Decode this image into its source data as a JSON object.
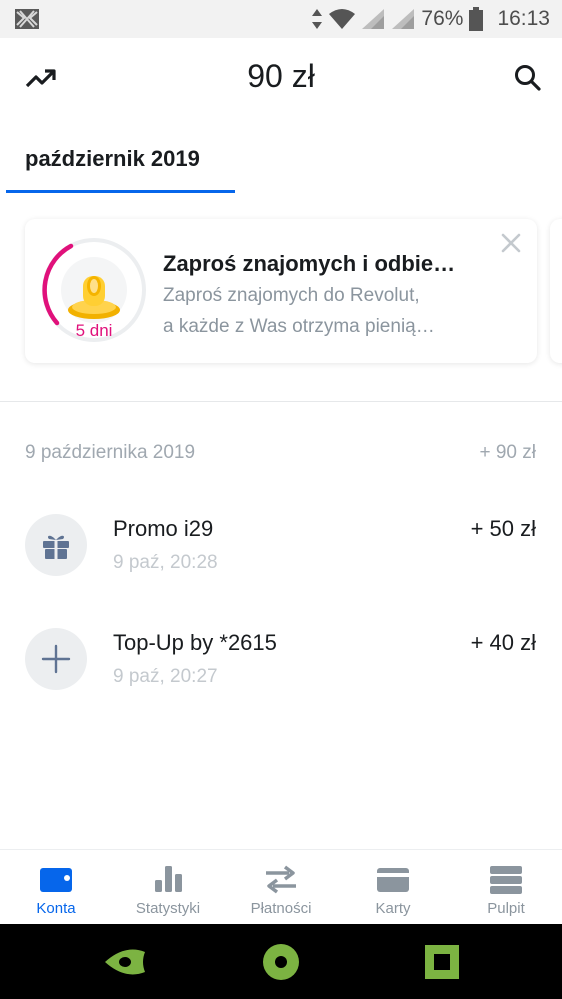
{
  "status_bar": {
    "battery": "76%",
    "time": "16:13"
  },
  "header": {
    "balance": "90 zł"
  },
  "tabs": [
    {
      "label": "październik 2019",
      "active": true
    }
  ],
  "promo": {
    "title": "Zaproś znajomych i odbie…",
    "line1": "Zaproś znajomych do Revolut,",
    "line2": "a każde z Was otrzyma pienią…",
    "days": "5 dni"
  },
  "date_group": {
    "date": "9 października 2019",
    "total": "+ 90 zł"
  },
  "transactions": [
    {
      "title": "Promo i29",
      "time": "9 paź, 20:28",
      "amount": "+ 50 zł",
      "icon": "gift-icon"
    },
    {
      "title": "Top-Up by *2615",
      "time": "9 paź, 20:27",
      "amount": "+ 40 zł",
      "icon": "plus-icon"
    }
  ],
  "bottom_nav": [
    {
      "label": "Konta",
      "icon": "wallet-icon",
      "active": true
    },
    {
      "label": "Statystyki",
      "icon": "bar-chart-icon",
      "active": false
    },
    {
      "label": "Płatności",
      "icon": "transfer-arrows-icon",
      "active": false
    },
    {
      "label": "Karty",
      "icon": "card-icon",
      "active": false
    },
    {
      "label": "Pulpit",
      "icon": "dashboard-icon",
      "active": false
    }
  ],
  "colors": {
    "accent": "#0666eb",
    "promo_ring": "#e0117b",
    "muted": "#8b959e"
  }
}
